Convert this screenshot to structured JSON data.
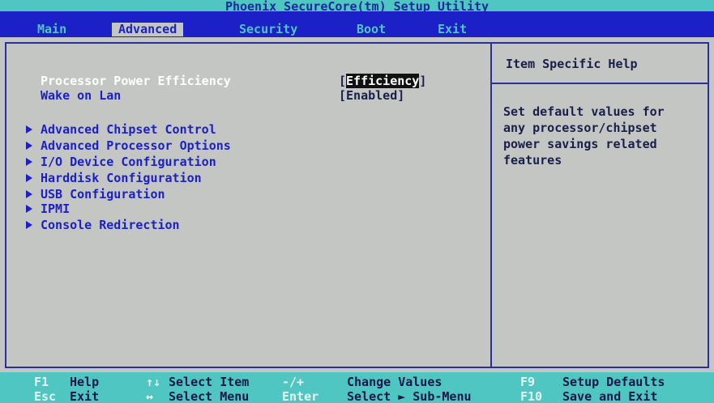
{
  "title": "Phoenix SecureCore(tm) Setup Utility",
  "menu": {
    "items": [
      {
        "label": "Main"
      },
      {
        "label": "Advanced"
      },
      {
        "label": "Security"
      },
      {
        "label": "Boot"
      },
      {
        "label": "Exit"
      }
    ],
    "active_index": 1
  },
  "settings": [
    {
      "label": "Processor Power Efficiency",
      "value_prefix": "[",
      "value": "Efficiency",
      "value_suffix": "]",
      "selected": true
    },
    {
      "label": "Wake on Lan",
      "value_prefix": "[",
      "value": "Enabled",
      "value_suffix": "]",
      "selected": false
    }
  ],
  "submenus": [
    {
      "label": "Advanced Chipset Control"
    },
    {
      "label": "Advanced Processor Options"
    },
    {
      "label": "I/O Device Configuration"
    },
    {
      "label": "Harddisk Configuration"
    },
    {
      "label": "USB Configuration"
    },
    {
      "label": "IPMI"
    },
    {
      "label": "Console Redirection"
    }
  ],
  "help": {
    "title": "Item Specific Help",
    "text": "Set default values for\nany processor/chipset\npower savings related\nfeatures"
  },
  "bottom": {
    "row1": [
      {
        "key": "F1",
        "desc": "Help"
      },
      {
        "key": "↑↓",
        "desc": "Select Item"
      },
      {
        "key": "-/+",
        "desc": "Change Values"
      },
      {
        "key": "F9",
        "desc": "Setup Defaults"
      }
    ],
    "row2": [
      {
        "key": "Esc",
        "desc": "Exit"
      },
      {
        "key": "↔",
        "desc": "Select Menu"
      },
      {
        "key": "Enter",
        "desc": "Select ► Sub-Menu"
      },
      {
        "key": "F10",
        "desc": "Save and Exit"
      }
    ]
  },
  "colors": {
    "background": "#c4c6c4",
    "menu_bar": "#1b21c6",
    "accent_cyan": "#4fc6c2",
    "text_blue": "#1b21c6",
    "text_dark": "#1a1f4a"
  }
}
